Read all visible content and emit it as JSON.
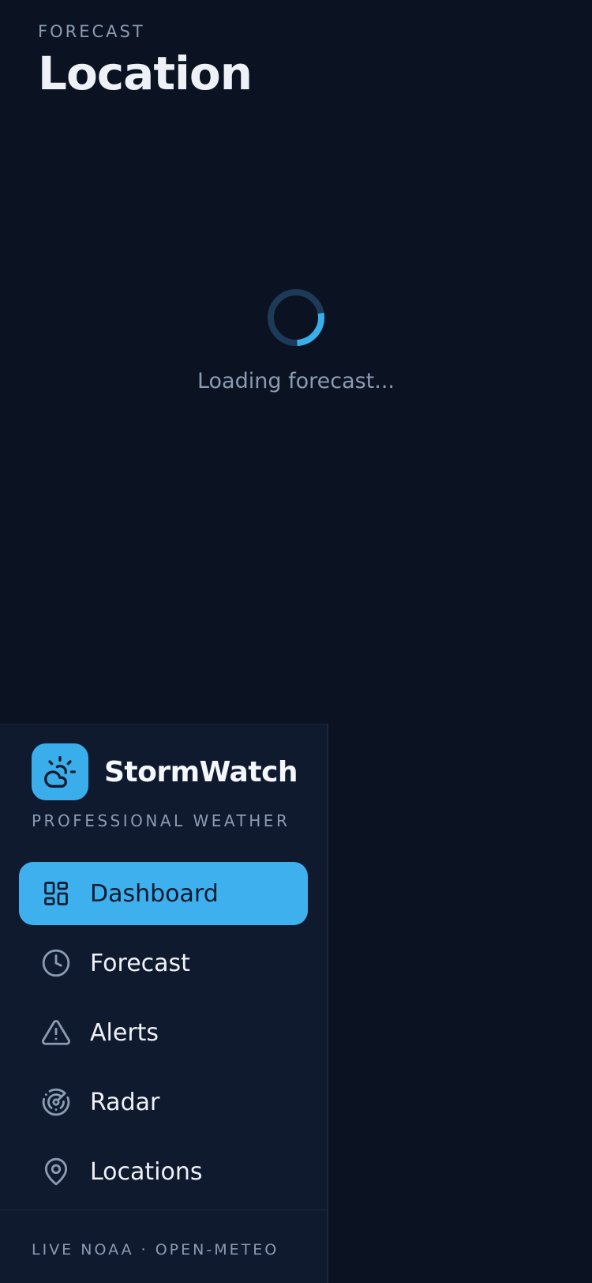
{
  "header": {
    "eyebrow": "FORECAST",
    "title": "Location"
  },
  "loading": {
    "text": "Loading forecast...",
    "progress": 0.27
  },
  "brand": {
    "name": "StormWatch",
    "subtitle": "PROFESSIONAL WEATHER",
    "logo_icon": "cloud-sun-icon"
  },
  "nav": {
    "items": [
      {
        "label": "Dashboard",
        "icon": "dashboard-grid-icon",
        "active": true
      },
      {
        "label": "Forecast",
        "icon": "clock-icon",
        "active": false
      },
      {
        "label": "Alerts",
        "icon": "warning-triangle-icon",
        "active": false
      },
      {
        "label": "Radar",
        "icon": "radar-icon",
        "active": false
      },
      {
        "label": "Locations",
        "icon": "map-pin-icon",
        "active": false
      }
    ]
  },
  "footer": {
    "text": "LIVE NOAA · OPEN-METEO"
  },
  "colors": {
    "background": "#0b1322",
    "sidebar": "#101a2e",
    "accent": "#3fb0ee",
    "muted_text": "#8a9bb2",
    "spinner_track": "#1d3a58"
  }
}
